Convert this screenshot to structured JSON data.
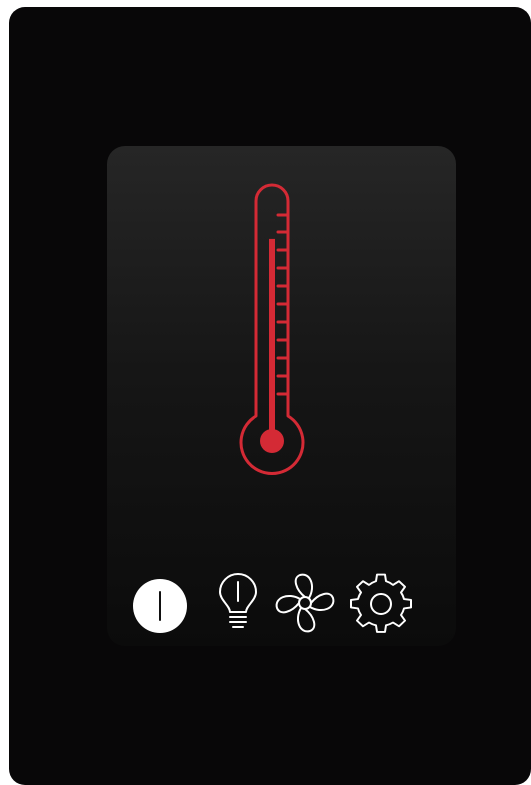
{
  "device": {
    "accent_color": "#d42a35",
    "icon_color": "#ffffff"
  },
  "thermometer": {
    "icon": "thermometer-icon",
    "level": 0.86
  },
  "controls": [
    {
      "icon": "power-icon",
      "state": "on"
    },
    {
      "icon": "light-bulb-icon"
    },
    {
      "icon": "fan-icon"
    },
    {
      "icon": "settings-gear-icon"
    }
  ]
}
